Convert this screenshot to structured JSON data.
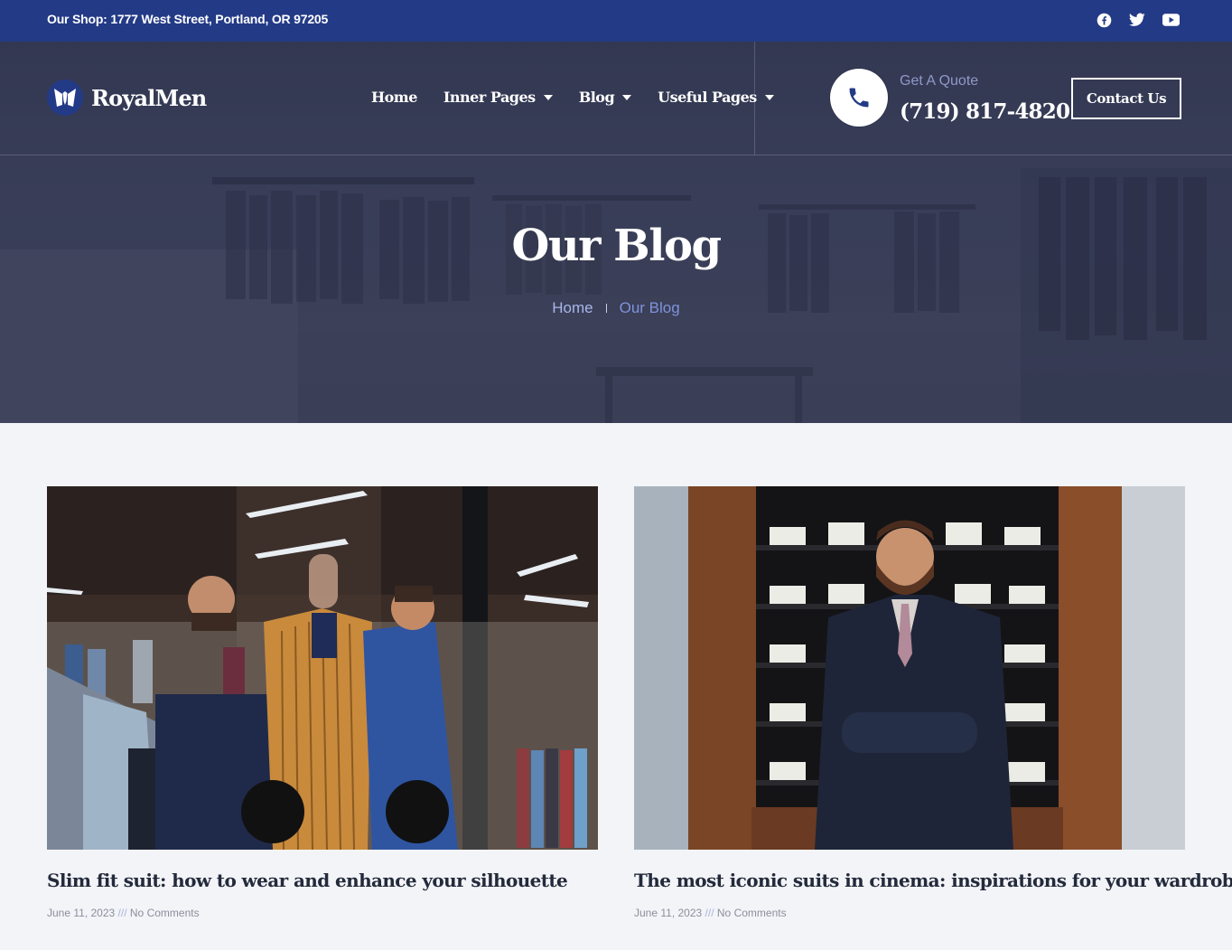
{
  "topbar": {
    "address": "Our Shop: 1777 West Street, Portland, OR 97205",
    "social": [
      {
        "icon": "facebook-icon"
      },
      {
        "icon": "twitter-icon"
      },
      {
        "icon": "youtube-icon"
      }
    ]
  },
  "header": {
    "logo_text": "RoyalMen",
    "nav": [
      {
        "label": "Home",
        "dropdown": false
      },
      {
        "label": "Inner Pages",
        "dropdown": true
      },
      {
        "label": "Blog",
        "dropdown": true
      },
      {
        "label": "Useful Pages",
        "dropdown": true
      }
    ],
    "quote_label": "Get A Quote",
    "phone_number": "(719) 817-4820",
    "contact_button": "Contact Us"
  },
  "hero": {
    "title": "Our Blog",
    "breadcrumb": {
      "home": "Home",
      "current": "Our Blog"
    }
  },
  "posts": [
    {
      "title": "Slim fit suit: how to wear and enhance your silhouette",
      "date": "June 11, 2023",
      "separator": "///",
      "comments": "No Comments"
    },
    {
      "title": "The most iconic suits in cinema: inspirations for your wardrobe",
      "date": "June 11, 2023",
      "separator": "///",
      "comments": "No Comments"
    }
  ],
  "colors": {
    "topbar_bg": "#233a86",
    "accent": "#7f93dc",
    "page_bg": "#f3f4f8"
  }
}
